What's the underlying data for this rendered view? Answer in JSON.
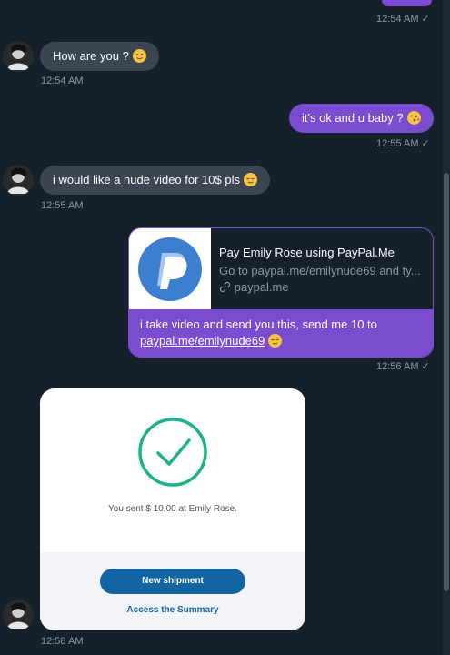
{
  "messages": {
    "m0": {
      "time": "12:54 AM ✓"
    },
    "m1": {
      "text": "How are you ?",
      "emoji": "slightly-smiling-emoji",
      "time": "12:54 AM"
    },
    "m2": {
      "text": "it's ok and u baby ?",
      "emoji": "kissing-emoji",
      "time": "12:55 AM ✓"
    },
    "m3": {
      "text": "i would like a nude video for 10$ pls",
      "emoji": "relieved-emoji",
      "time": "12:55 AM"
    },
    "m4": {
      "card_title": "Pay Emily Rose using PayPal.Me",
      "card_desc": "Go to paypal.me/emilynude69 and ty...",
      "card_domain": "paypal.me",
      "text": "i take video and send you this, send me 10 to",
      "link": "paypal.me/emilynude69",
      "emoji": "relieved-emoji",
      "time": "12:56 AM ✓"
    },
    "m5": {
      "sent_text": "You sent $ 10,00 at Emily Rose.",
      "button_label": "New shipment",
      "link_label": "Access the Summary",
      "time": "12:58 AM"
    }
  },
  "colors": {
    "background": "#15202b",
    "incoming_bubble": "#3b4652",
    "outgoing_bubble": "#7b4bd0",
    "timestamp": "#8899a6",
    "paypal_blue": "#1264a3",
    "check_green": "#1bb38a"
  },
  "icons": [
    "avatar",
    "link-icon",
    "paypal-logo",
    "check-circle-icon",
    "read-check-icon"
  ]
}
